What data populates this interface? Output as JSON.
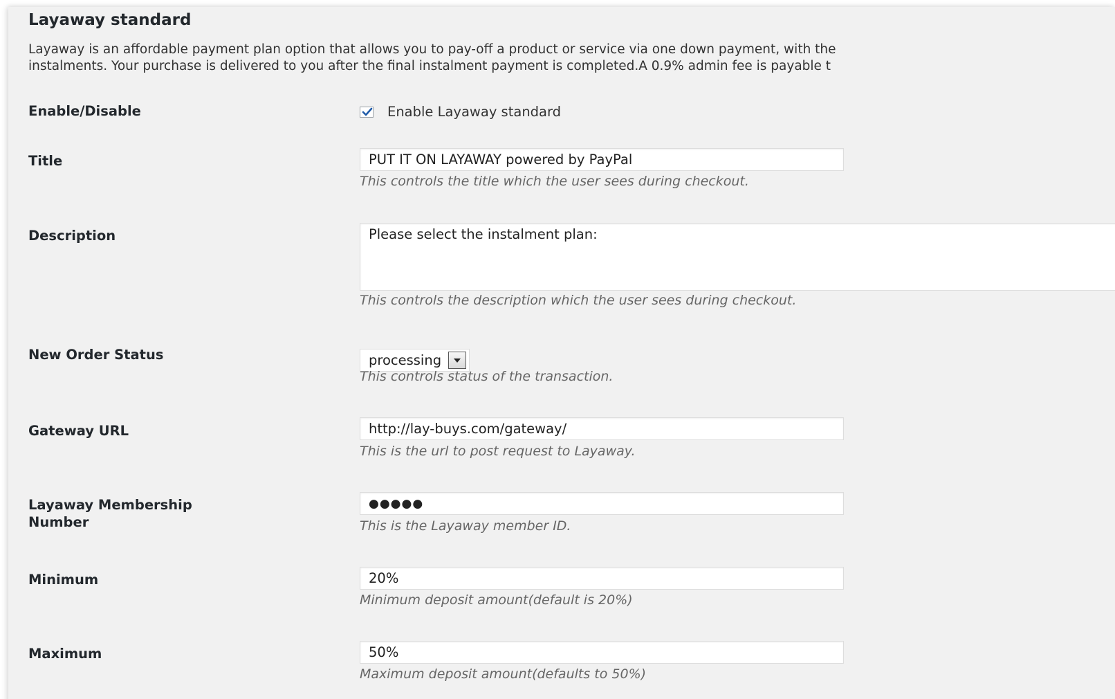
{
  "section": {
    "title": "Layaway standard",
    "intro_line1": "Layaway is an affordable payment plan option that allows you to pay-off a product or service via one down payment, with the",
    "intro_line2": "instalments. Your purchase is delivered to you after the final instalment payment is completed.A 0.9% admin fee is payable t"
  },
  "enable": {
    "label": "Enable/Disable",
    "checkbox_label": "Enable Layaway standard",
    "checked": true
  },
  "title_field": {
    "label": "Title",
    "value": "PUT IT ON LAYAWAY powered by PayPal",
    "help": "This controls the title which the user sees during checkout."
  },
  "description_field": {
    "label": "Description",
    "value": "Please select the instalment plan:",
    "help": "This controls the description which the user sees during checkout."
  },
  "order_status": {
    "label": "New Order Status",
    "selected": "processing",
    "help": "This controls status of the transaction."
  },
  "gateway_url": {
    "label": "Gateway URL",
    "value": "http://lay-buys.com/gateway/",
    "help": "This is the url to post request to Layaway."
  },
  "membership": {
    "label_line1": "Layaway Membership",
    "label_line2": "Number",
    "value": "●●●●●",
    "help": "This is the Layaway member ID."
  },
  "minimum": {
    "label": "Minimum",
    "value": "20%",
    "help": "Minimum deposit amount(default is 20%)"
  },
  "maximum": {
    "label": "Maximum",
    "value": "50%",
    "help": "Maximum deposit amount(defaults to 50%)"
  },
  "colors": {
    "panel_bg": "#f1f1f1",
    "checkmark": "#1e5aa8",
    "help_text": "#666666"
  }
}
